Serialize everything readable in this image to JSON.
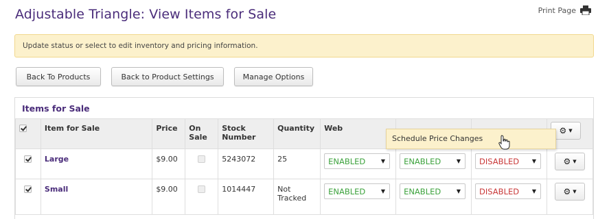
{
  "page": {
    "title": "Adjustable Triangle: View Items for Sale",
    "print_label": "Print Page",
    "print_icon": "printer-icon"
  },
  "notice": {
    "text": "Update status or select to edit inventory and pricing information."
  },
  "buttons": {
    "back_to_products": "Back To Products",
    "back_to_settings": "Back to Product Settings",
    "manage_options": "Manage Options"
  },
  "panel": {
    "title": "Items for Sale"
  },
  "table": {
    "headers": {
      "item": "Item for Sale",
      "price": "Price",
      "on_sale_1": "On",
      "on_sale_2": "Sale",
      "stock_1": "Stock",
      "stock_2": "Number",
      "quantity": "Quantity",
      "web": "Web"
    },
    "rows": [
      {
        "checked": true,
        "item": "Large",
        "price": "$9.00",
        "on_sale": false,
        "stock": "5243072",
        "quantity_1": "25",
        "quantity_2": "",
        "web": "ENABLED",
        "col2": "ENABLED",
        "col3": "DISABLED"
      },
      {
        "checked": true,
        "item": "Small",
        "price": "$9.00",
        "on_sale": false,
        "stock": "1014447",
        "quantity_1": "Not",
        "quantity_2": "Tracked",
        "web": "ENABLED",
        "col2": "ENABLED",
        "col3": "DISABLED"
      }
    ]
  },
  "dropdown_menu": {
    "item": "Schedule Price Changes"
  },
  "colors": {
    "title": "#4a2c7a",
    "enabled": "#3ea33e",
    "disabled": "#c93939",
    "notice_bg": "#fcf1cc"
  }
}
